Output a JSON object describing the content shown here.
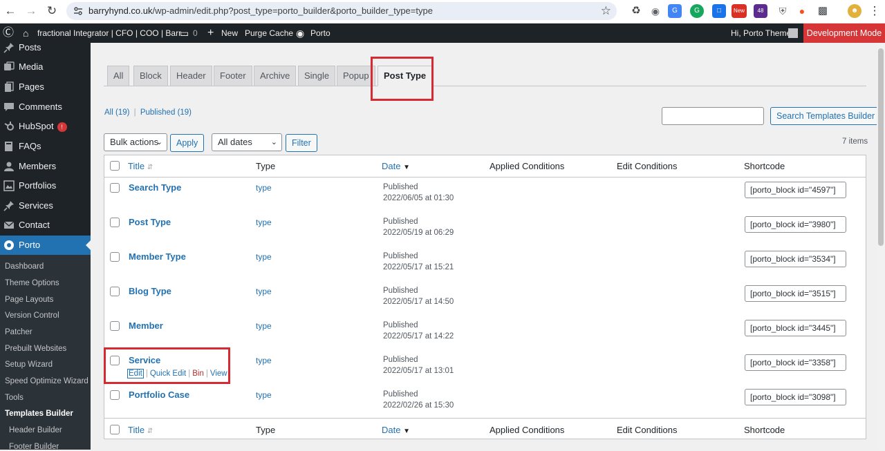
{
  "browser": {
    "url_host": "barryhynd.co.uk",
    "url_path": "/wp-admin/edit.php?post_type=porto_builder&porto_builder_type=type",
    "ext_badge": "48",
    "new_badge": "New"
  },
  "adminbar": {
    "site_name": "fractional Integrator | CFO | COO | Barr...",
    "comments_count": "0",
    "new_label": "New",
    "purge_cache": "Purge Cache",
    "porto": "Porto",
    "greeting": "Hi, Porto Theme",
    "dev_mode": "Development Mode"
  },
  "sidebar": {
    "items": [
      {
        "label": "Posts",
        "icon": "pin-icon"
      },
      {
        "label": "Media",
        "icon": "media-icon"
      },
      {
        "label": "Pages",
        "icon": "pages-icon"
      },
      {
        "label": "Comments",
        "icon": "comment-icon"
      },
      {
        "label": "HubSpot",
        "icon": "hubspot-icon",
        "badge": "!"
      },
      {
        "label": "FAQs",
        "icon": "faq-icon"
      },
      {
        "label": "Members",
        "icon": "members-icon"
      },
      {
        "label": "Portfolios",
        "icon": "portfolio-icon"
      },
      {
        "label": "Services",
        "icon": "services-icon"
      },
      {
        "label": "Contact",
        "icon": "mail-icon"
      },
      {
        "label": "Porto",
        "icon": "porto-icon"
      }
    ],
    "sub_items": [
      "Dashboard",
      "Theme Options",
      "Page Layouts",
      "Version Control",
      "Patcher",
      "Prebuilt Websites",
      "Setup Wizard",
      "Speed Optimize Wizard",
      "Tools",
      "Templates Builder",
      "Header Builder",
      "Footer Builder"
    ]
  },
  "tabs": [
    "All",
    "Block",
    "Header",
    "Footer",
    "Archive",
    "Single",
    "Popup",
    "Post Type"
  ],
  "filters": {
    "all": "All",
    "all_count": "(19)",
    "published": "Published",
    "published_count": "(19)",
    "search_button": "Search Templates Builder",
    "search_value": "",
    "bulk_actions": "Bulk actions",
    "apply": "Apply",
    "dates": "All dates",
    "filter": "Filter",
    "items_count": "7 items"
  },
  "columns": {
    "title": "Title",
    "type": "Type",
    "date": "Date",
    "applied": "Applied Conditions",
    "edit": "Edit Conditions",
    "shortcode": "Shortcode"
  },
  "rows": [
    {
      "title": "Search Type",
      "type": "type",
      "status": "Published",
      "date": "2022/06/05 at 01:30",
      "shortcode": "[porto_block id=\"4597\"]"
    },
    {
      "title": "Post Type",
      "type": "type",
      "status": "Published",
      "date": "2022/05/19 at 06:29",
      "shortcode": "[porto_block id=\"3980\"]"
    },
    {
      "title": "Member Type",
      "type": "type",
      "status": "Published",
      "date": "2022/05/17 at 15:21",
      "shortcode": "[porto_block id=\"3534\"]"
    },
    {
      "title": "Blog Type",
      "type": "type",
      "status": "Published",
      "date": "2022/05/17 at 14:50",
      "shortcode": "[porto_block id=\"3515\"]"
    },
    {
      "title": "Member",
      "type": "type",
      "status": "Published",
      "date": "2022/05/17 at 14:22",
      "shortcode": "[porto_block id=\"3445\"]"
    },
    {
      "title": "Service",
      "type": "type",
      "status": "Published",
      "date": "2022/05/17 at 13:01",
      "shortcode": "[porto_block id=\"3358\"]"
    },
    {
      "title": "Portfolio Case",
      "type": "type",
      "status": "Published",
      "date": "2022/02/26 at 15:30",
      "shortcode": "[porto_block id=\"3098\"]"
    }
  ],
  "row_actions": {
    "edit": "Edit",
    "quick_edit": "Quick Edit",
    "bin": "Bin",
    "view": "View"
  },
  "colors": {
    "accent": "#2271b1",
    "highlight": "#d62a32",
    "dev_mode": "#d63638"
  }
}
